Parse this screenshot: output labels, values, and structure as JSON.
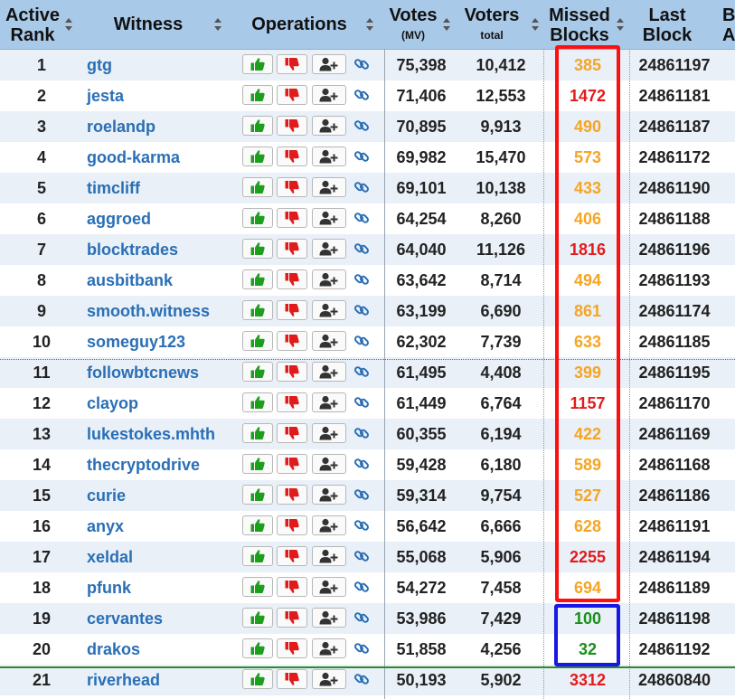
{
  "header": {
    "active_rank": [
      "Active",
      "Rank"
    ],
    "witness": "Witness",
    "operations": "Operations",
    "votes": "Votes",
    "votes_unit": "(MV)",
    "voters": "Voters",
    "voters_unit": "total",
    "missed": [
      "Missed",
      "Blocks"
    ],
    "last": [
      "Last",
      "Block"
    ],
    "next_cut": [
      "B",
      "A"
    ]
  },
  "icons": {
    "approve": "thumbs-up-icon",
    "unapprove": "thumbs-down-icon",
    "proxy": "user-plus-icon",
    "link": "link-icon"
  },
  "colors": {
    "header_bg": "#a9c9e8",
    "row_alt": "#e9f0f8",
    "link": "#2a6fb6",
    "missed_orange": "#f5a524",
    "missed_red": "#e31b1b",
    "missed_green": "#1a8f1a",
    "highlight_red": "#ff1010",
    "highlight_blue": "#1717e6"
  },
  "rows": [
    {
      "rank": "1",
      "witness": "gtg",
      "votes": "75,398",
      "voters": "10,412",
      "missed": "385",
      "missed_level": "orange",
      "last_block": "24861197"
    },
    {
      "rank": "2",
      "witness": "jesta",
      "votes": "71,406",
      "voters": "12,553",
      "missed": "1472",
      "missed_level": "red",
      "last_block": "24861181"
    },
    {
      "rank": "3",
      "witness": "roelandp",
      "votes": "70,895",
      "voters": "9,913",
      "missed": "490",
      "missed_level": "orange",
      "last_block": "24861187"
    },
    {
      "rank": "4",
      "witness": "good-karma",
      "votes": "69,982",
      "voters": "15,470",
      "missed": "573",
      "missed_level": "orange",
      "last_block": "24861172"
    },
    {
      "rank": "5",
      "witness": "timcliff",
      "votes": "69,101",
      "voters": "10,138",
      "missed": "433",
      "missed_level": "orange",
      "last_block": "24861190"
    },
    {
      "rank": "6",
      "witness": "aggroed",
      "votes": "64,254",
      "voters": "8,260",
      "missed": "406",
      "missed_level": "orange",
      "last_block": "24861188"
    },
    {
      "rank": "7",
      "witness": "blocktrades",
      "votes": "64,040",
      "voters": "11,126",
      "missed": "1816",
      "missed_level": "red",
      "last_block": "24861196"
    },
    {
      "rank": "8",
      "witness": "ausbitbank",
      "votes": "63,642",
      "voters": "8,714",
      "missed": "494",
      "missed_level": "orange",
      "last_block": "24861193"
    },
    {
      "rank": "9",
      "witness": "smooth.witness",
      "votes": "63,199",
      "voters": "6,690",
      "missed": "861",
      "missed_level": "orange",
      "last_block": "24861174"
    },
    {
      "rank": "10",
      "witness": "someguy123",
      "votes": "62,302",
      "voters": "7,739",
      "missed": "633",
      "missed_level": "orange",
      "last_block": "24861185"
    },
    {
      "rank": "11",
      "witness": "followbtcnews",
      "votes": "61,495",
      "voters": "4,408",
      "missed": "399",
      "missed_level": "orange",
      "last_block": "24861195"
    },
    {
      "rank": "12",
      "witness": "clayop",
      "votes": "61,449",
      "voters": "6,764",
      "missed": "1157",
      "missed_level": "red",
      "last_block": "24861170"
    },
    {
      "rank": "13",
      "witness": "lukestokes.mhth",
      "votes": "60,355",
      "voters": "6,194",
      "missed": "422",
      "missed_level": "orange",
      "last_block": "24861169"
    },
    {
      "rank": "14",
      "witness": "thecryptodrive",
      "votes": "59,428",
      "voters": "6,180",
      "missed": "589",
      "missed_level": "orange",
      "last_block": "24861168"
    },
    {
      "rank": "15",
      "witness": "curie",
      "votes": "59,314",
      "voters": "9,754",
      "missed": "527",
      "missed_level": "orange",
      "last_block": "24861186"
    },
    {
      "rank": "16",
      "witness": "anyx",
      "votes": "56,642",
      "voters": "6,666",
      "missed": "628",
      "missed_level": "orange",
      "last_block": "24861191"
    },
    {
      "rank": "17",
      "witness": "xeldal",
      "votes": "55,068",
      "voters": "5,906",
      "missed": "2255",
      "missed_level": "red",
      "last_block": "24861194"
    },
    {
      "rank": "18",
      "witness": "pfunk",
      "votes": "54,272",
      "voters": "7,458",
      "missed": "694",
      "missed_level": "orange",
      "last_block": "24861189"
    },
    {
      "rank": "19",
      "witness": "cervantes",
      "votes": "53,986",
      "voters": "7,429",
      "missed": "100",
      "missed_level": "green",
      "last_block": "24861198"
    },
    {
      "rank": "20",
      "witness": "drakos",
      "votes": "51,858",
      "voters": "4,256",
      "missed": "32",
      "missed_level": "green",
      "last_block": "24861192"
    },
    {
      "rank": "21",
      "witness": "riverhead",
      "votes": "50,193",
      "voters": "5,902",
      "missed": "3312",
      "missed_level": "red",
      "last_block": "24860840"
    }
  ]
}
